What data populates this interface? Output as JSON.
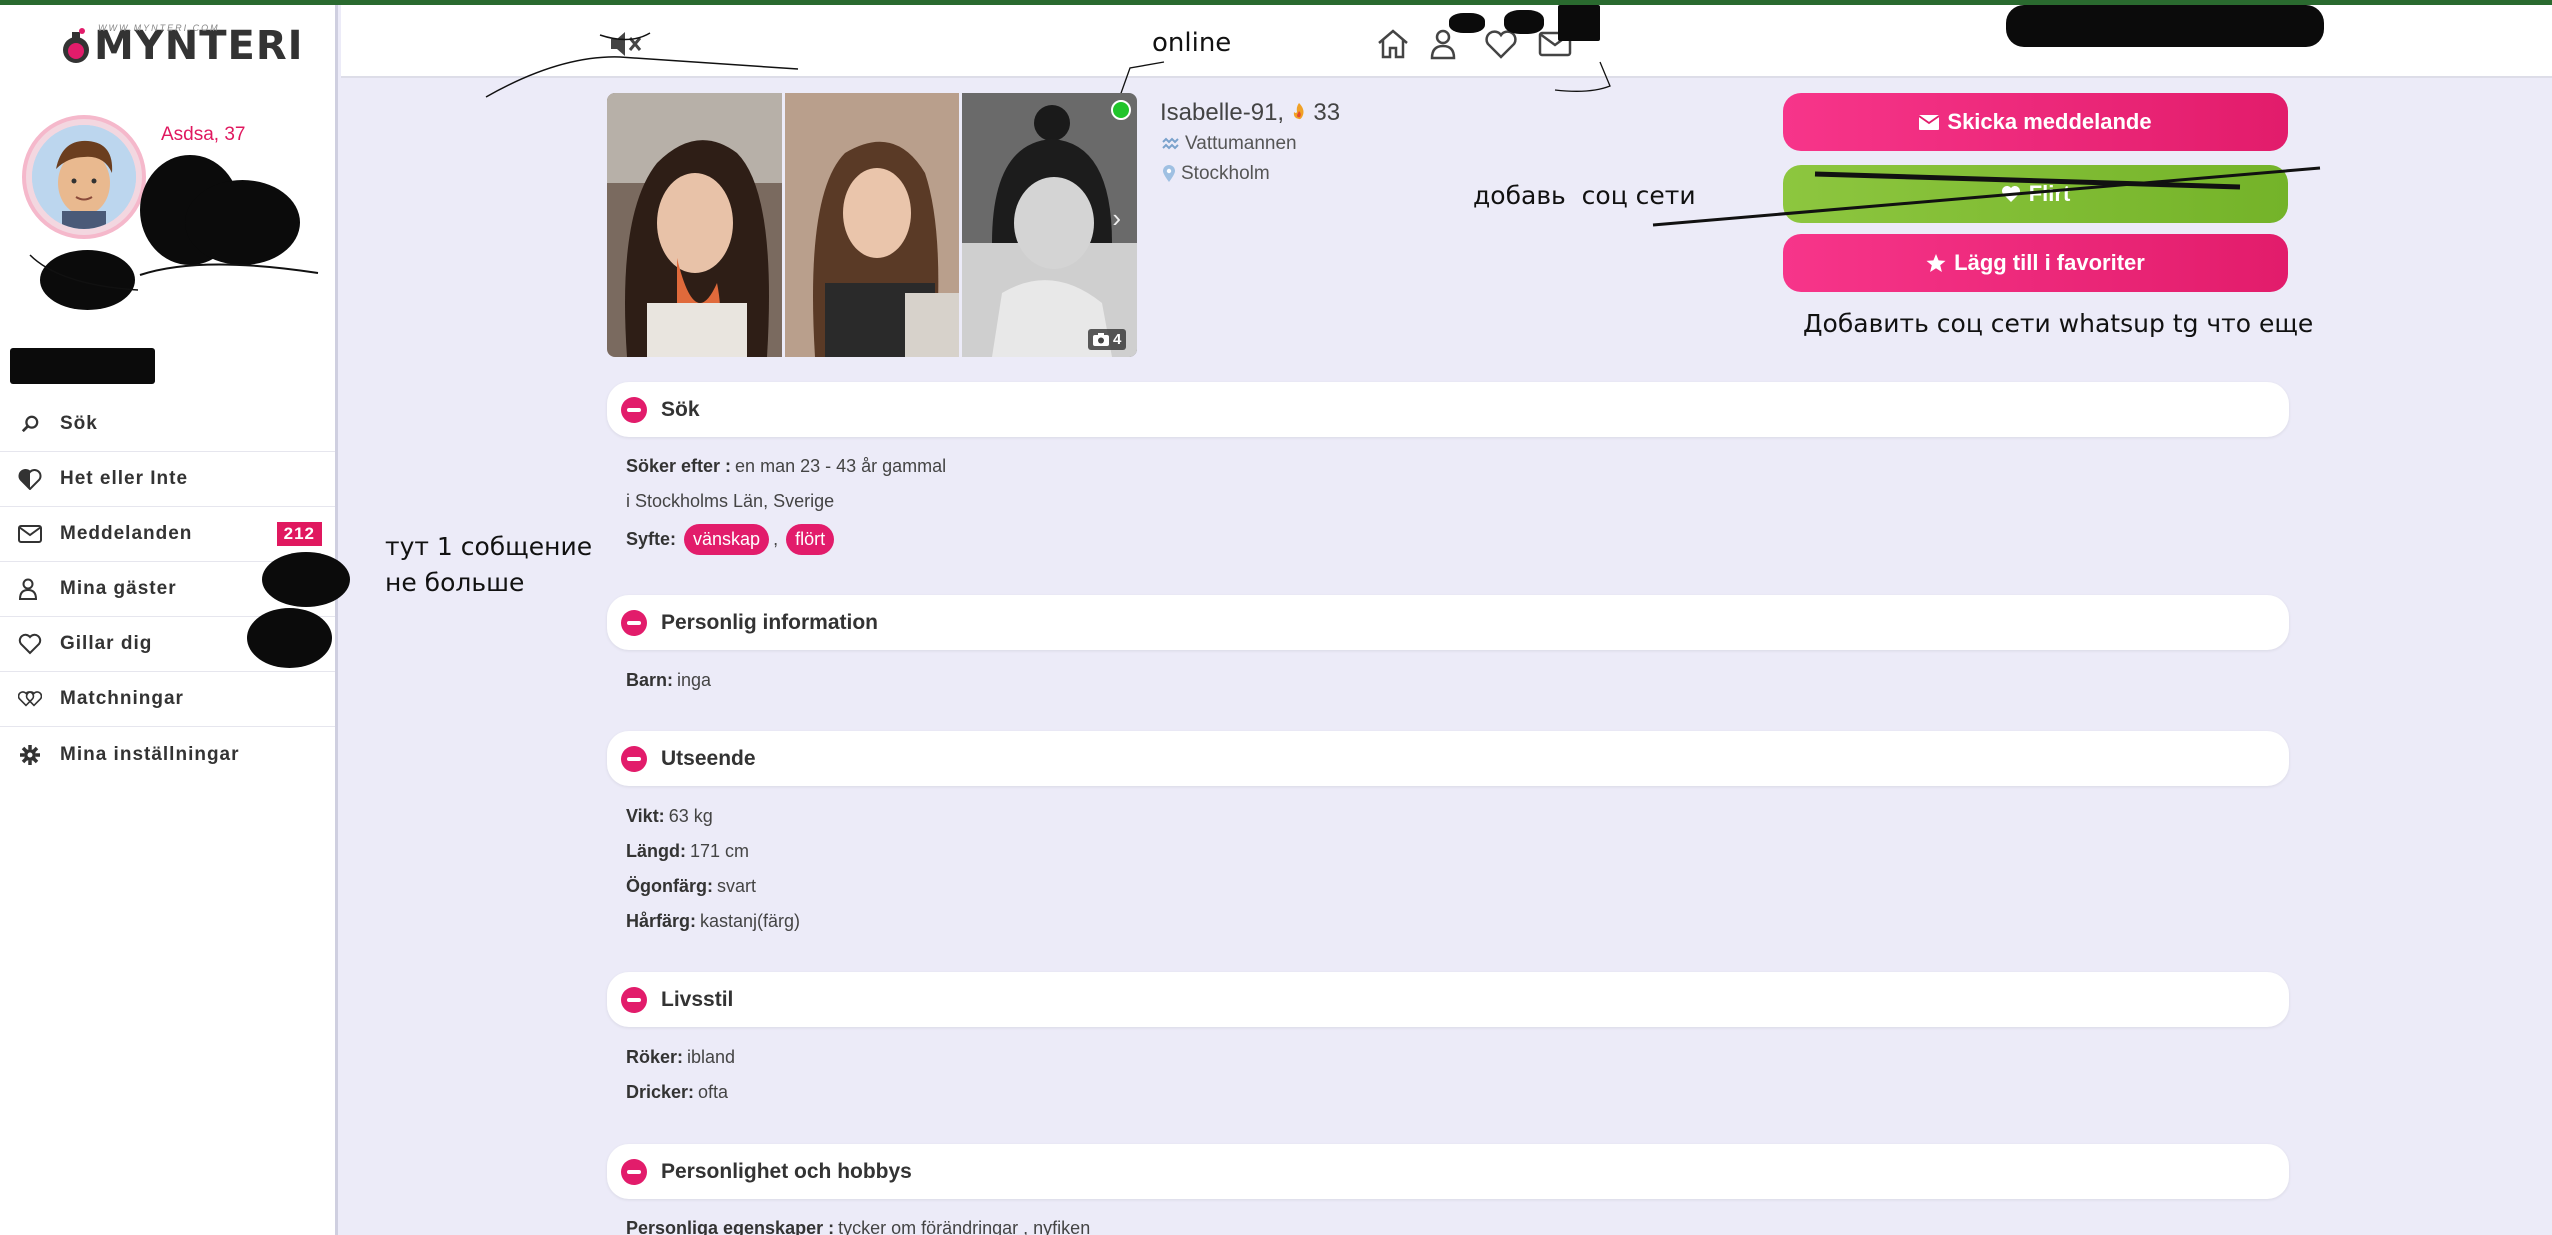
{
  "app": {
    "logo_text": "MYNTERI",
    "logo_sub": "WWW.MYNTERI.COM"
  },
  "user": {
    "name_age": "Asdsa, 37"
  },
  "sidebar": {
    "items": [
      {
        "label": "Sök",
        "icon": "search-icon"
      },
      {
        "label": "Het eller Inte",
        "icon": "heart-half-icon"
      },
      {
        "label": "Meddelanden",
        "icon": "envelope-icon",
        "badge": "212"
      },
      {
        "label": "Mina gäster",
        "icon": "people-icon"
      },
      {
        "label": "Gillar dig",
        "icon": "heart-icon"
      },
      {
        "label": "Matchningar",
        "icon": "double-heart-icon"
      },
      {
        "label": "Mina inställningar",
        "icon": "gear-icon"
      }
    ]
  },
  "header": {
    "icons": [
      "mute-icon",
      "home-icon",
      "people-icon",
      "heart-icon",
      "envelope-icon"
    ]
  },
  "profile": {
    "name": "Isabelle-91,",
    "age": "33",
    "sign": "Vattumannen",
    "city": "Stockholm",
    "photo_count": "4"
  },
  "actions": {
    "message_label": "Skicka meddelande",
    "flirt_label": "Flirt",
    "favorite_label": "Lägg till i favoriter"
  },
  "notes": {
    "online": "online",
    "add_social": "добавь  соц сети",
    "add_social_long": "Добавить соц сети whatsup tg что еще",
    "one_message_line1": "тут 1 собщение",
    "one_message_line2": "не больше"
  },
  "sections": {
    "search": {
      "title": "Sök",
      "seeking_label": "Söker efter :",
      "seeking_value": "en man 23 - 43 år gammal",
      "location": "i Stockholms Län, Sverige",
      "purpose_label": "Syfte:",
      "tags": [
        "vänskap",
        "flört"
      ],
      "sep": ","
    },
    "personal": {
      "title": "Personlig information",
      "children_label": "Barn:",
      "children_value": "inga"
    },
    "appearance": {
      "title": "Utseende",
      "rows": [
        {
          "label": "Vikt:",
          "value": "63 kg"
        },
        {
          "label": "Längd:",
          "value": "171 cm"
        },
        {
          "label": "Ögonfärg:",
          "value": "svart"
        },
        {
          "label": "Hårfärg:",
          "value": "kastanj(färg)"
        }
      ]
    },
    "lifestyle": {
      "title": "Livsstil",
      "rows": [
        {
          "label": "Röker:",
          "value": "ibland"
        },
        {
          "label": "Dricker:",
          "value": "ofta"
        }
      ]
    },
    "personality": {
      "title": "Personlighet och hobbys",
      "traits_label": "Personliga egenskaper :",
      "traits_value": "tycker om förändringar , nyfiken"
    }
  },
  "colors": {
    "accent": "#e21c6b",
    "green": "#8dc63f",
    "online": "#21c42b",
    "background": "#ecebf8"
  }
}
